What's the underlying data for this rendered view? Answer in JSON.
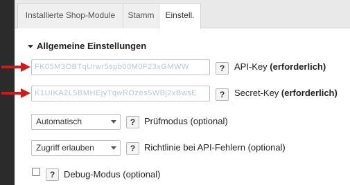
{
  "tabs": [
    {
      "label": "Installierte Shop-Module",
      "active": false
    },
    {
      "label": "Stamm",
      "active": false
    },
    {
      "label": "Einstell.",
      "active": true
    }
  ],
  "section": {
    "title": "Allgemeine Einstellungen"
  },
  "fields": {
    "api_key": {
      "value": "FK05M3OBTqUrwr5spb00M0F23xGMWW",
      "label_plain": "API-Key ",
      "label_bold": "(erforderlich)",
      "help": "?"
    },
    "secret_key": {
      "value": "K1UIKA2L5BMHEjyTqwROzes5WBj2xBwsE",
      "label_plain": "Secret-Key ",
      "label_bold": "(erforderlich)",
      "help": "?"
    },
    "pruefmodus": {
      "selected": "Automatisch",
      "label": "Prüfmodus (optional)",
      "help": "?"
    },
    "richtlinie": {
      "selected": "Zugriff erlauben",
      "label": "Richtlinie bei API-Fehlern (optional)",
      "help": "?"
    },
    "debug": {
      "checked": false,
      "label": "Debug-Modus (optional)",
      "help": "?"
    }
  },
  "colors": {
    "arrow": "#d11a1a",
    "sidebar": "#2b2b2b",
    "tabbar": "#e9e9e9"
  }
}
